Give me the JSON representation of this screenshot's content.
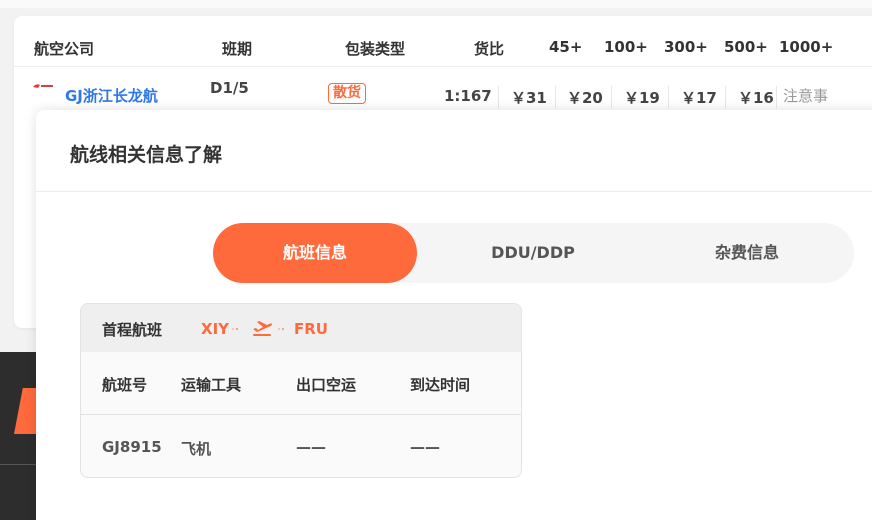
{
  "table": {
    "headers": [
      "航空公司",
      "班期",
      "包装类型",
      "货比",
      "45+",
      "100+",
      "300+",
      "500+",
      "1000+"
    ],
    "row": {
      "airline": "GJ浙江长龙航",
      "schedule": "D1/5",
      "pack_type": "散货",
      "ratio": "1:167",
      "prices": [
        "￥31",
        "￥20",
        "￥19",
        "￥17",
        "￥16"
      ],
      "notice": "注意事项"
    }
  },
  "modal": {
    "title": "航线相关信息了解",
    "tabs": [
      {
        "label": "航班信息",
        "active": true
      },
      {
        "label": "DDU/DDP",
        "active": false
      },
      {
        "label": "杂费信息",
        "active": false
      }
    ],
    "route": {
      "label": "首程航班",
      "origin": "XIY",
      "destination": "FRU",
      "columns": [
        "航班号",
        "运输工具",
        "出口空运",
        "到达时间"
      ],
      "rows": [
        [
          "GJ8915",
          "飞机",
          "——",
          "——"
        ]
      ]
    }
  },
  "colors": {
    "accent": "#ff6a3c",
    "link": "#2f78e8",
    "dark_panel": "#2d2d2d"
  },
  "icons": {
    "airline_logo": "airline-logo",
    "plane": "plane-takeoff-icon"
  }
}
